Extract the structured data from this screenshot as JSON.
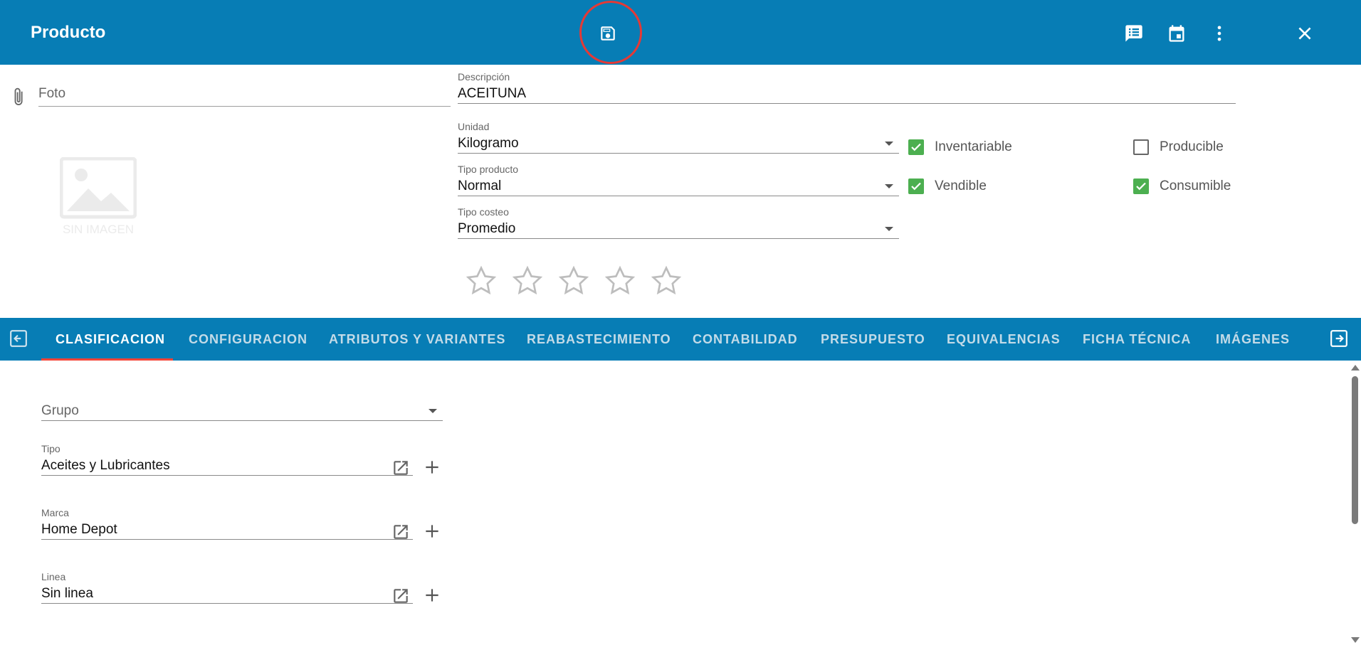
{
  "header": {
    "title": "Producto",
    "bg_color": "#077db5",
    "icons": [
      "save-icon",
      "comment-list-icon",
      "calendar-icon",
      "more-vert-icon",
      "close-icon"
    ]
  },
  "photo": {
    "label": "Foto",
    "no_image_text": "SIN IMAGEN"
  },
  "form": {
    "descripcion": {
      "label": "Descripción",
      "value": "ACEITUNA"
    },
    "unidad": {
      "label": "Unidad",
      "value": "Kilogramo"
    },
    "tipo_producto": {
      "label": "Tipo producto",
      "value": "Normal"
    },
    "tipo_costeo": {
      "label": "Tipo costeo",
      "value": "Promedio"
    },
    "checkboxes": [
      {
        "label": "Inventariable",
        "checked": true
      },
      {
        "label": "Producible",
        "checked": false
      },
      {
        "label": "Vendible",
        "checked": true
      },
      {
        "label": "Consumible",
        "checked": true
      }
    ],
    "rating": {
      "value": 0,
      "max": 5
    }
  },
  "tabs": [
    {
      "label": "CLASIFICACION",
      "active": true
    },
    {
      "label": "CONFIGURACION",
      "active": false
    },
    {
      "label": "ATRIBUTOS Y VARIANTES",
      "active": false
    },
    {
      "label": "REABASTECIMIENTO",
      "active": false
    },
    {
      "label": "CONTABILIDAD",
      "active": false
    },
    {
      "label": "PRESUPUESTO",
      "active": false
    },
    {
      "label": "EQUIVALENCIAS",
      "active": false
    },
    {
      "label": "FICHA TÉCNICA",
      "active": false
    },
    {
      "label": "IMÁGENES",
      "active": false
    }
  ],
  "clasificacion": {
    "grupo": {
      "placeholder": "Grupo",
      "value": ""
    },
    "tipo": {
      "label": "Tipo",
      "value": "Aceites y Lubricantes"
    },
    "marca": {
      "label": "Marca",
      "value": "Home Depot"
    },
    "linea": {
      "label": "Linea",
      "value": "Sin linea"
    }
  },
  "colors": {
    "accent": "#077db5",
    "check_on": "#4caf50",
    "tab_indicator": "#f44336",
    "highlight_ring": "#e53935"
  }
}
